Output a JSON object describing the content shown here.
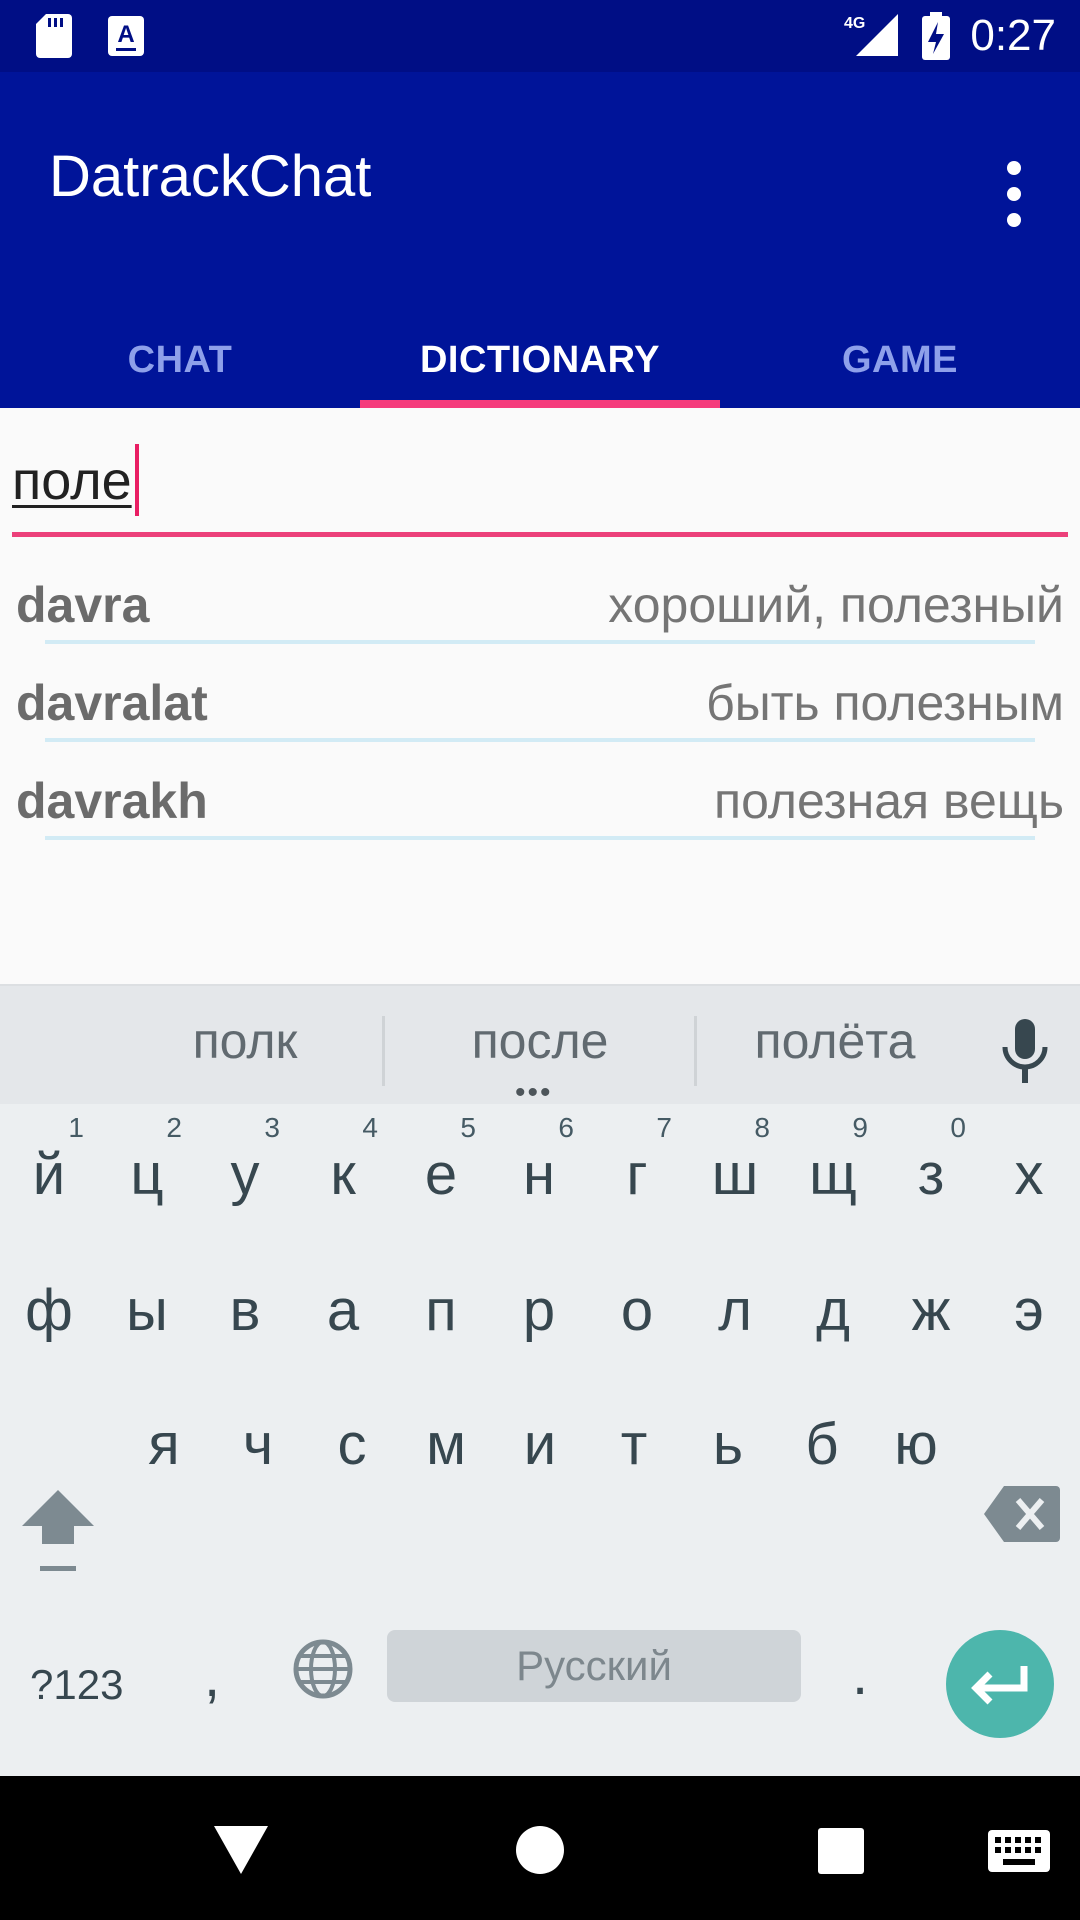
{
  "status_bar": {
    "time": "0:27",
    "network": "4G",
    "icons": [
      "sd-card-icon",
      "keyboard-notification-icon",
      "signal-icon",
      "battery-charging-icon"
    ]
  },
  "app": {
    "title": "DatrackChat",
    "overflow_icon": "more-vert-icon"
  },
  "tabs": [
    {
      "label": "CHAT",
      "active": false
    },
    {
      "label": "DICTIONARY",
      "active": true
    },
    {
      "label": "GAME",
      "active": false
    }
  ],
  "search": {
    "value": "поле"
  },
  "results": [
    {
      "word": "davra",
      "translation": "хороший, полезный"
    },
    {
      "word": "davralat",
      "translation": "быть полезным"
    },
    {
      "word": "davrakh",
      "translation": "полезная вещь"
    }
  ],
  "keyboard": {
    "suggestions": [
      "полк",
      "после",
      "полёта"
    ],
    "more_suggestions": "•••",
    "row1": [
      {
        "char": "й",
        "hint": "1"
      },
      {
        "char": "ц",
        "hint": "2"
      },
      {
        "char": "у",
        "hint": "3"
      },
      {
        "char": "к",
        "hint": "4"
      },
      {
        "char": "е",
        "hint": "5"
      },
      {
        "char": "н",
        "hint": "6"
      },
      {
        "char": "г",
        "hint": "7"
      },
      {
        "char": "ш",
        "hint": "8"
      },
      {
        "char": "щ",
        "hint": "9"
      },
      {
        "char": "з",
        "hint": "0"
      },
      {
        "char": "х",
        "hint": ""
      }
    ],
    "row2": [
      "ф",
      "ы",
      "в",
      "а",
      "п",
      "р",
      "о",
      "л",
      "д",
      "ж",
      "э"
    ],
    "row3": [
      "я",
      "ч",
      "с",
      "м",
      "и",
      "т",
      "ь",
      "б",
      "ю"
    ],
    "symbols_label": "?123",
    "comma_label": ",",
    "space_label": "Русский",
    "period_label": ".",
    "accent_color": "#4db6ac"
  },
  "colors": {
    "status_bar": "#000e85",
    "app_bar": "#001499",
    "tab_indicator": "#f53b7c"
  }
}
